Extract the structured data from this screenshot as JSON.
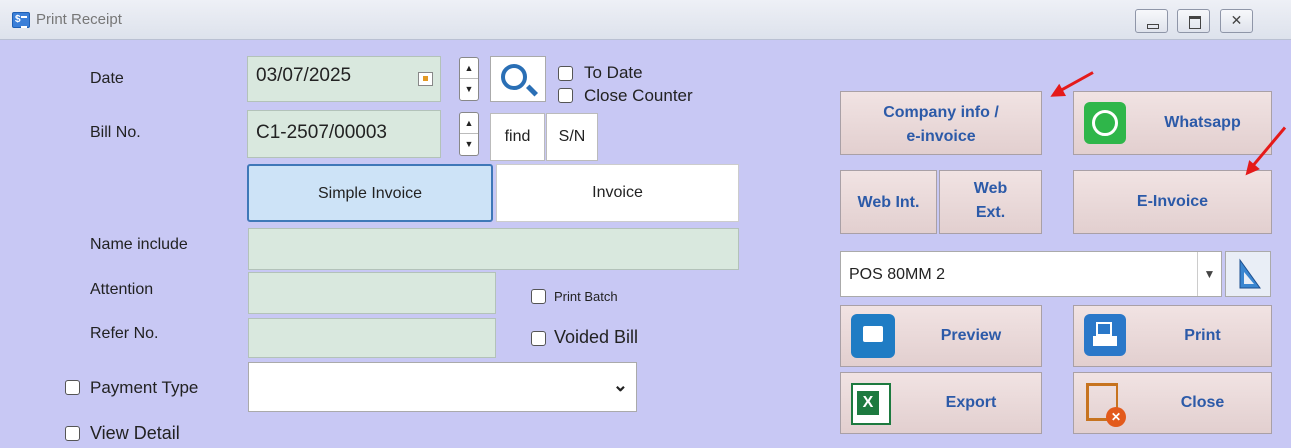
{
  "window": {
    "title": "Print Receipt",
    "app_icon_text": "$",
    "close_glyph": "✕"
  },
  "labels": {
    "date": "Date",
    "bill_no": "Bill No.",
    "name_include": "Name include",
    "attention": "Attention",
    "refer_no": "Refer No."
  },
  "fields": {
    "date": "03/07/2025",
    "bill_no": "C1-2507/00003",
    "name_include": "",
    "attention": "",
    "refer_no": "",
    "payment_type": ""
  },
  "buttons": {
    "find": "find",
    "sn": "S/N",
    "company_info_line1": "Company info /",
    "company_info_line2": "e-invoice",
    "whatsapp": "Whatsapp",
    "web_int": "Web Int.",
    "web_ext_line1": "Web",
    "web_ext_line2": "Ext.",
    "e_invoice": "E-Invoice",
    "preview": "Preview",
    "print": "Print",
    "export": "Export",
    "close": "Close"
  },
  "tabs": {
    "simple_invoice": "Simple Invoice",
    "invoice": "Invoice",
    "active": "Simple Invoice"
  },
  "checkboxes": {
    "to_date": {
      "label": "To Date",
      "checked": false
    },
    "close_counter": {
      "label": "Close Counter",
      "checked": false
    },
    "print_batch": {
      "label": "Print Batch",
      "checked": false
    },
    "voided_bill": {
      "label": "Voided Bill",
      "checked": false
    },
    "payment_type": {
      "label": "Payment Type",
      "checked": false
    },
    "view_detail": {
      "label": "View Detail",
      "checked": false
    }
  },
  "printer": {
    "selected": "POS 80MM 2"
  },
  "colors": {
    "background": "#c8c8f4",
    "accent_text": "#2c5aa8",
    "annotation_arrow": "#e51a1a"
  }
}
